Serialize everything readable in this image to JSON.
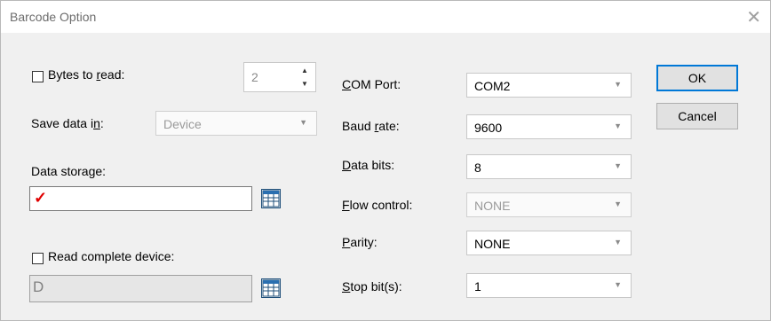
{
  "window": {
    "title": "Barcode Option",
    "close_glyph": "✕"
  },
  "left": {
    "bytes_to_read": {
      "label_pre": "Bytes to ",
      "label_u": "r",
      "label_post": "ead:",
      "checked": false,
      "value": "2"
    },
    "save_data_in": {
      "label_pre": "Save data i",
      "label_u": "n",
      "label_post": ":",
      "value": "Device"
    },
    "data_storage": {
      "label": "Data storage:",
      "value": "✓"
    },
    "read_complete_device": {
      "label": "Read complete device:",
      "checked": false,
      "value": "D"
    }
  },
  "right": {
    "com_port": {
      "label_u": "C",
      "label_post": "OM Port:",
      "value": "COM2"
    },
    "baud_rate": {
      "label_pre": "Baud ",
      "label_u": "r",
      "label_post": "ate:",
      "value": "9600"
    },
    "data_bits": {
      "label_u": "D",
      "label_post": "ata bits:",
      "value": "8"
    },
    "flow_control": {
      "label_u": "F",
      "label_post": "low control:",
      "value": "NONE"
    },
    "parity": {
      "label_u": "P",
      "label_post": "arity:",
      "value": "NONE"
    },
    "stop_bits": {
      "label_u": "S",
      "label_post": "top bit(s):",
      "value": "1"
    }
  },
  "buttons": {
    "ok": "OK",
    "cancel": "Cancel"
  },
  "colors": {
    "accent": "#0078d7",
    "checkmark": "#e00000"
  }
}
